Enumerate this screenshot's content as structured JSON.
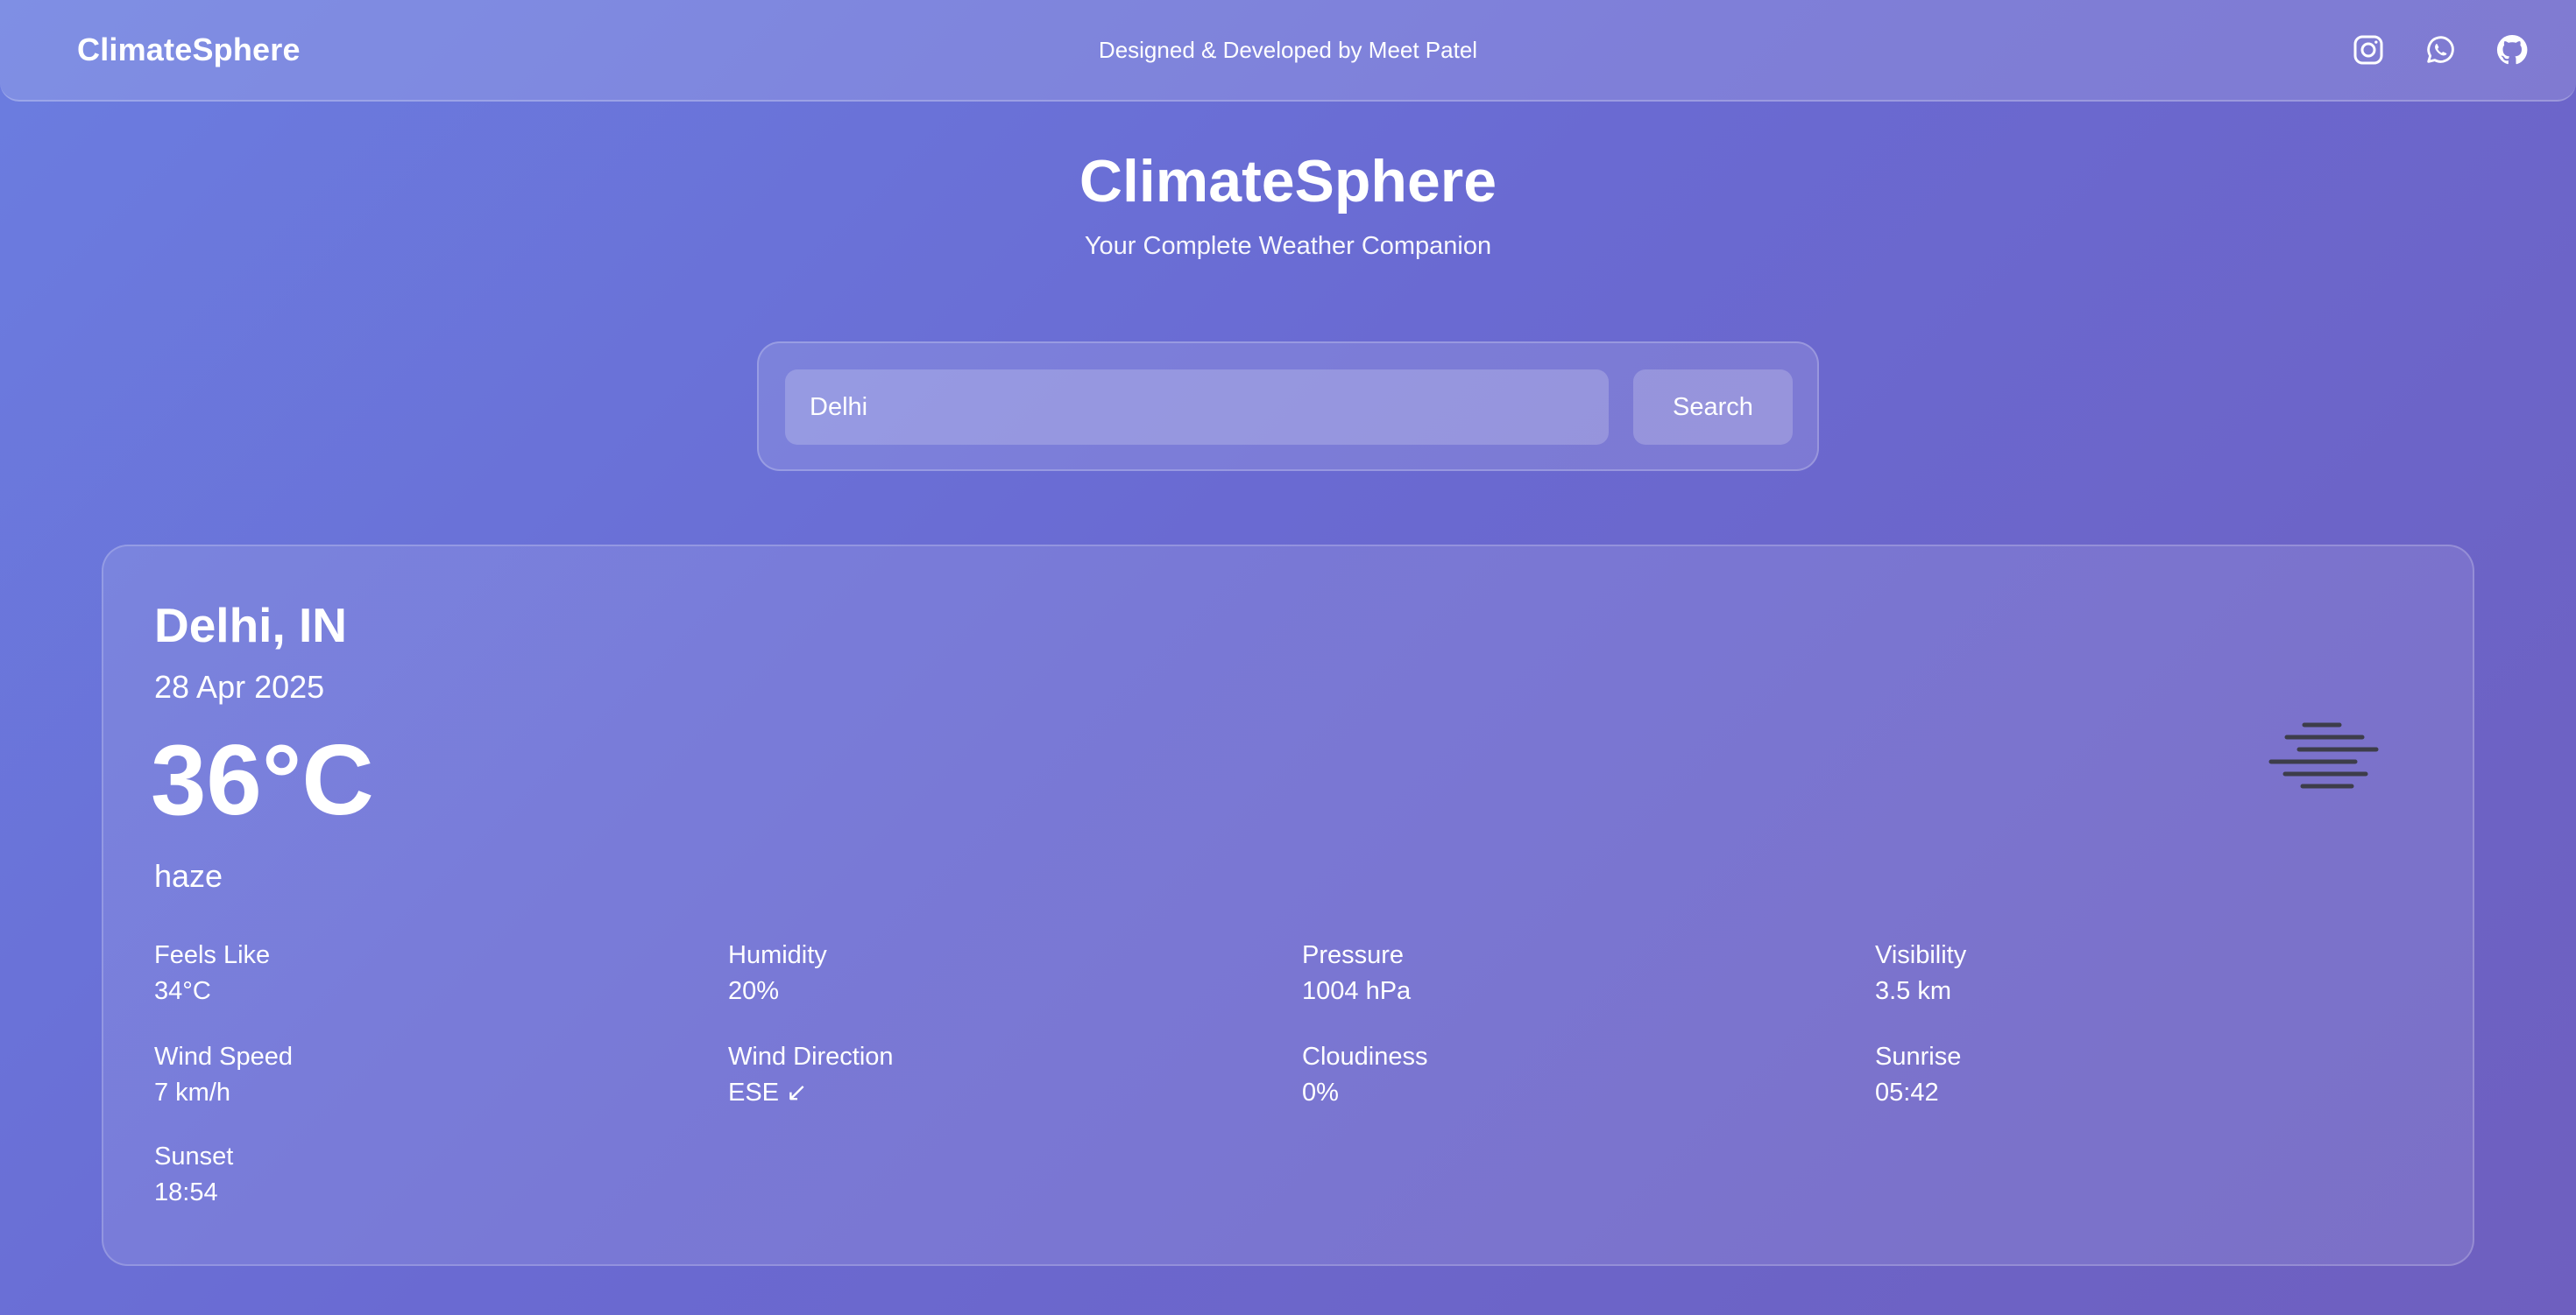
{
  "header": {
    "brand": "ClimateSphere",
    "credit": "Designed & Developed by Meet Patel",
    "socials": [
      {
        "icon": "instagram-icon"
      },
      {
        "icon": "whatsapp-icon"
      },
      {
        "icon": "github-icon"
      }
    ]
  },
  "hero": {
    "title": "ClimateSphere",
    "subtitle": "Your Complete Weather Companion"
  },
  "search": {
    "value": "Delhi",
    "button_label": "Search"
  },
  "weather": {
    "location": "Delhi, IN",
    "date": "28 Apr 2025",
    "temperature": "36°C",
    "description": "haze",
    "icon": "haze-icon",
    "details": [
      {
        "label": "Feels Like",
        "value": "34°C"
      },
      {
        "label": "Humidity",
        "value": "20%"
      },
      {
        "label": "Pressure",
        "value": "1004 hPa"
      },
      {
        "label": "Visibility",
        "value": "3.5 km"
      },
      {
        "label": "Wind Speed",
        "value": "7 km/h"
      },
      {
        "label": "Wind Direction",
        "value": "ESE ↙"
      },
      {
        "label": "Cloudiness",
        "value": "0%"
      },
      {
        "label": "Sunrise",
        "value": "05:42"
      },
      {
        "label": "Sunset",
        "value": "18:54"
      }
    ]
  },
  "colors": {
    "background_start": "#6b7de0",
    "background_end": "#6e5fbf",
    "text": "#ffffff",
    "icon_dark": "#3d3d4a"
  }
}
